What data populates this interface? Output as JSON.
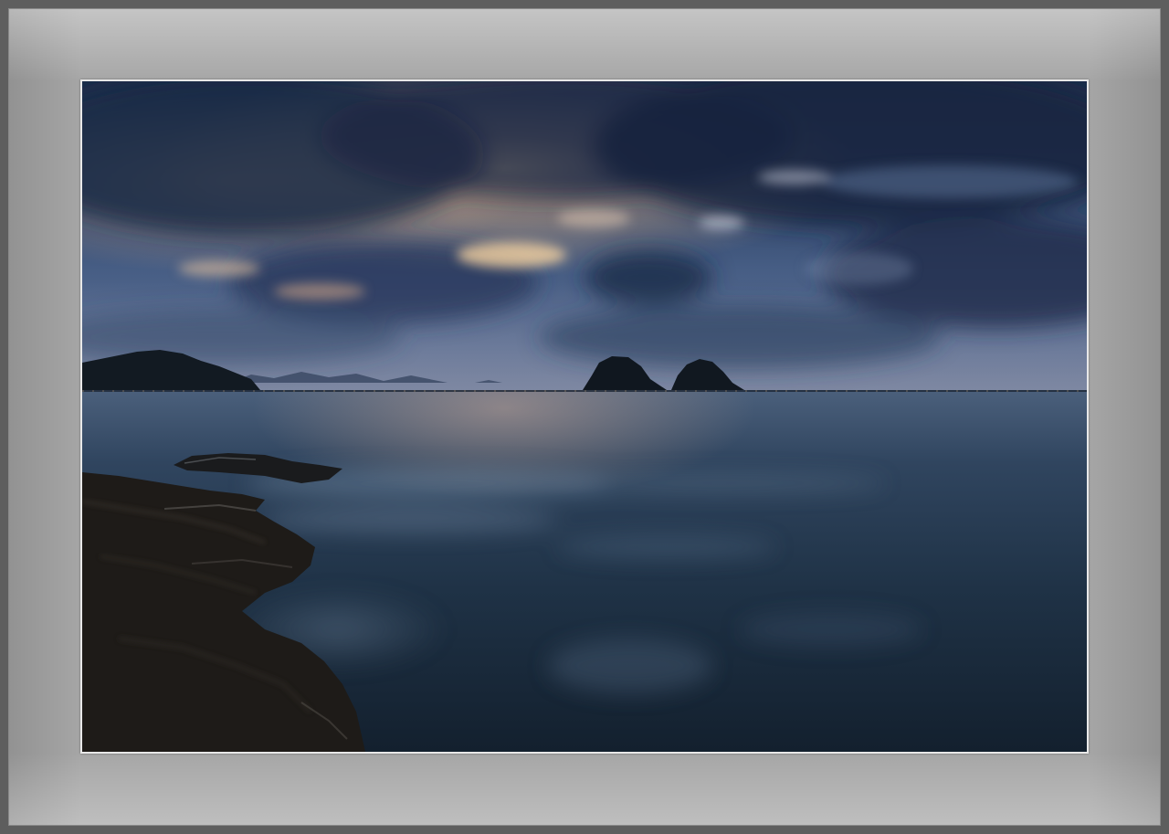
{
  "image": {
    "subject": "coastal-seascape-at-dusk",
    "colors": {
      "mat": "#a6a6a6",
      "outer_frame": "#5e5e5e",
      "sky_dark": "#1c2a45",
      "sky_mid": "#3a4f75",
      "glow": "#f2c48a",
      "sea_dark": "#14202f",
      "sea_mid": "#26394e",
      "rock": "#1d1a17"
    }
  }
}
